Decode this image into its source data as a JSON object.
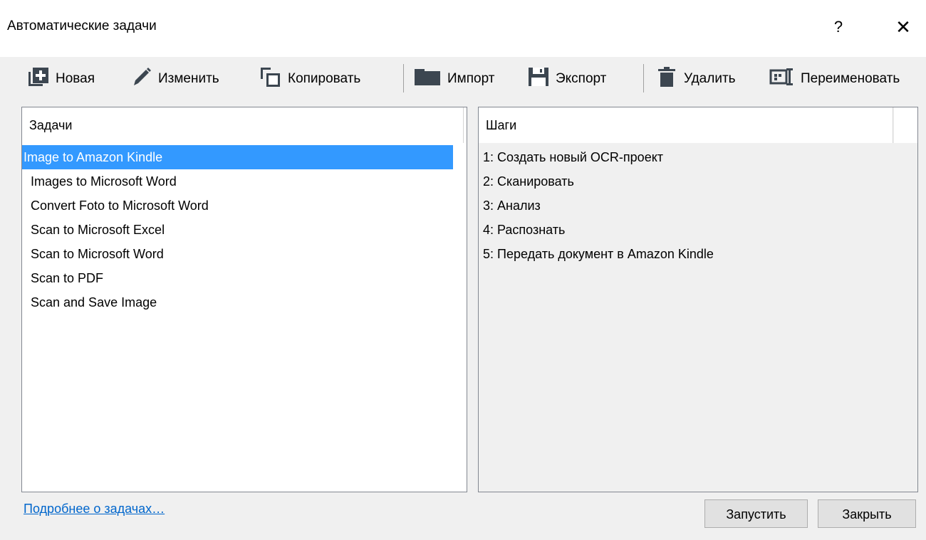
{
  "window": {
    "title": "Автоматические задачи",
    "help_label": "?",
    "close_label": "✕"
  },
  "toolbar": {
    "new_label": "Новая",
    "edit_label": "Изменить",
    "copy_label": "Копировать",
    "import_label": "Импорт",
    "export_label": "Экспорт",
    "delete_label": "Удалить",
    "rename_label": "Переименовать"
  },
  "tasks": {
    "header": "Задачи",
    "items": [
      "Image to Amazon Kindle",
      "Images to Microsoft Word",
      "Convert Foto to Microsoft Word",
      "Scan to Microsoft Excel",
      "Scan to Microsoft Word",
      "Scan to PDF",
      "Scan and Save Image"
    ],
    "selected_index": 0
  },
  "steps": {
    "header": "Шаги",
    "items": [
      "1: Создать новый OCR-проект",
      "2: Сканировать",
      "3: Анализ",
      "4: Распознать",
      "5: Передать документ в Amazon Kindle"
    ]
  },
  "footer": {
    "more_link": "Подробнее о задачах…",
    "run_label": "Запустить",
    "close_label": "Закрыть"
  },
  "colors": {
    "selection": "#3399ff",
    "link": "#0066cc",
    "icon": "#3c4650"
  }
}
